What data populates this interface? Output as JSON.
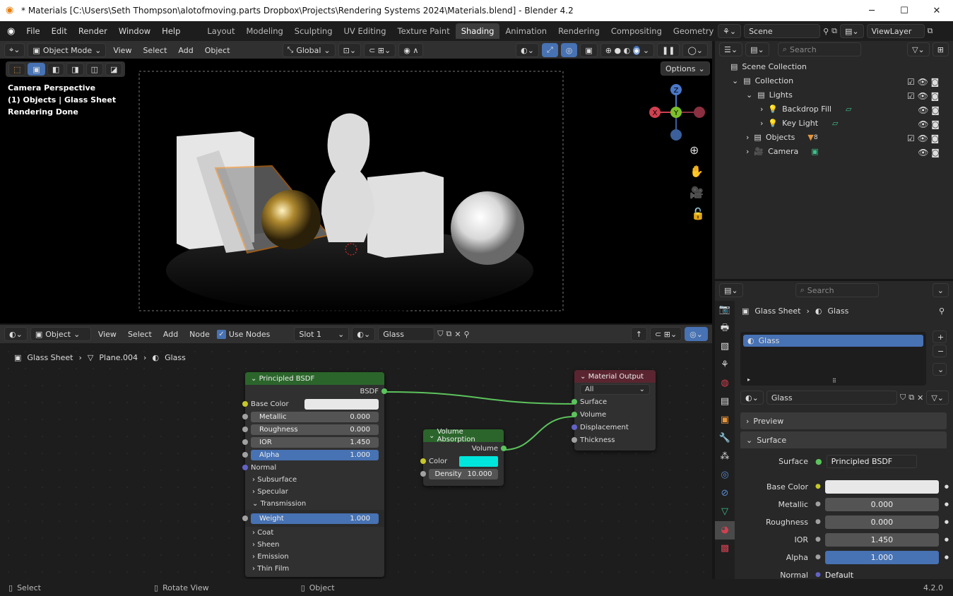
{
  "window": {
    "title": "* Materials [C:\\Users\\Seth Thompson\\alotofmoving.parts Dropbox\\Projects\\Rendering Systems 2024\\Materials.blend] - Blender 4.2",
    "min": "─",
    "max": "☐",
    "close": "✕"
  },
  "menu": [
    "File",
    "Edit",
    "Render",
    "Window",
    "Help"
  ],
  "workspaces": [
    "Layout",
    "Modeling",
    "Sculpting",
    "UV Editing",
    "Texture Paint",
    "Shading",
    "Animation",
    "Rendering",
    "Compositing",
    "Geometry N"
  ],
  "active_workspace": "Shading",
  "scene": {
    "name": "Scene",
    "view_layer": "ViewLayer"
  },
  "viewport": {
    "mode": "Object Mode",
    "menus": [
      "View",
      "Select",
      "Add",
      "Object"
    ],
    "orientation": "Global",
    "options": "Options",
    "overlay_lines": [
      "Camera Perspective",
      "(1) Objects | Glass Sheet",
      "Rendering Done"
    ],
    "gizmo": {
      "x": "X",
      "y": "Y",
      "z": "Z"
    }
  },
  "node_editor": {
    "type": "Object",
    "menus": [
      "View",
      "Select",
      "Add",
      "Node"
    ],
    "use_nodes": "Use Nodes",
    "slot": "Slot 1",
    "material": "Glass",
    "breadcrumb": [
      "Glass Sheet",
      "Plane.004",
      "Glass"
    ]
  },
  "nodes": {
    "principled": {
      "title": "Principled BSDF",
      "output": "BSDF",
      "base_color": "Base Color",
      "base_color_value": "#e8e8e8",
      "fields": [
        {
          "label": "Metallic",
          "value": "0.000"
        },
        {
          "label": "Roughness",
          "value": "0.000"
        },
        {
          "label": "IOR",
          "value": "1.450"
        },
        {
          "label": "Alpha",
          "value": "1.000"
        }
      ],
      "normal": "Normal",
      "panels": [
        "Subsurface",
        "Specular",
        "Transmission"
      ],
      "weight": {
        "label": "Weight",
        "value": "1.000"
      },
      "panels2": [
        "Coat",
        "Sheen",
        "Emission",
        "Thin Film"
      ]
    },
    "volume": {
      "title": "Volume Absorption",
      "output": "Volume",
      "color": "Color",
      "color_value": "#00e5dc",
      "density": {
        "label": "Density",
        "value": "10.000"
      }
    },
    "output": {
      "title": "Material Output",
      "target": "All",
      "inputs": [
        "Surface",
        "Volume",
        "Displacement",
        "Thickness"
      ]
    }
  },
  "outliner": {
    "search_placeholder": "Search",
    "items": [
      {
        "label": "Scene Collection"
      },
      {
        "label": "Collection"
      },
      {
        "label": "Lights"
      },
      {
        "label": "Backdrop Fill"
      },
      {
        "label": "Key Light"
      },
      {
        "label": "Objects",
        "badge": "8"
      },
      {
        "label": "Camera"
      }
    ]
  },
  "properties": {
    "search_placeholder": "Search",
    "breadcrumb": [
      "Glass Sheet",
      "Glass"
    ],
    "slot": "Glass",
    "material": "Glass",
    "panels": [
      "Preview",
      "Surface"
    ],
    "surface": {
      "label": "Surface",
      "value": "Principled BSDF"
    },
    "rows": [
      {
        "label": "Base Color",
        "value": ""
      },
      {
        "label": "Metallic",
        "value": "0.000"
      },
      {
        "label": "Roughness",
        "value": "0.000"
      },
      {
        "label": "IOR",
        "value": "1.450"
      },
      {
        "label": "Alpha",
        "value": "1.000"
      },
      {
        "label": "Normal",
        "value": "Default"
      }
    ]
  },
  "status": {
    "select": "Select",
    "rotate": "Rotate View",
    "object": "Object",
    "version": "4.2.0"
  },
  "colors": {
    "accent": "#4772b3",
    "shader_header": "#2b652b",
    "output_header": "#5a2530",
    "link": "#5cc35c",
    "selection": "#f08a1e"
  }
}
